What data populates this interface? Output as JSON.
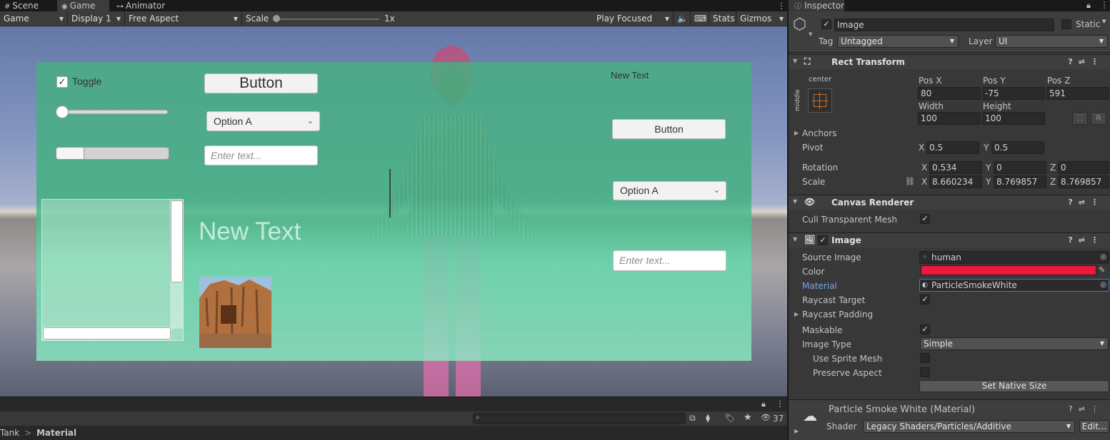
{
  "tabs": {
    "scene": "Scene",
    "game": "Game",
    "animator": "Animator",
    "more": "⋮"
  },
  "game_toolbar": {
    "mode": "Game",
    "display": "Display 1",
    "aspect": "Free Aspect",
    "scale_label": "Scale",
    "scale_value": "1x",
    "play_mode": "Play Focused",
    "stats": "Stats",
    "gizmos": "Gizmos"
  },
  "game_ui": {
    "toggle_label": "Toggle",
    "toggle_checked": "✓",
    "button1": "Button",
    "dropdown1": "Option A",
    "input1_placeholder": "Enter text...",
    "big_text": "New Text",
    "top_right_text": "New Text",
    "button2": "Button",
    "dropdown2": "Option A",
    "input2_placeholder": "Enter text...",
    "slider_value": 0.0,
    "progress_value": 0.25
  },
  "bottom_panel": {
    "search_placeholder": "",
    "hidden_count": "37",
    "breadcrumb_parent": "Tank",
    "breadcrumb_sep": ">",
    "breadcrumb_current": "Material"
  },
  "inspector": {
    "tab": "Inspector",
    "object_name": "Image",
    "active_checked": "✓",
    "static_label": "Static",
    "tag_label": "Tag",
    "tag_value": "Untagged",
    "layer_label": "Layer",
    "layer_value": "UI",
    "rect_transform": {
      "title": "Rect Transform",
      "anchor_h": "center",
      "anchor_v": "middle",
      "posx_label": "Pos X",
      "posy_label": "Pos Y",
      "posz_label": "Pos Z",
      "posx": "80",
      "posy": "-75",
      "posz": "591",
      "width_label": "Width",
      "height_label": "Height",
      "width": "100",
      "height": "100",
      "r_button": "R",
      "anchors_label": "Anchors",
      "pivot_label": "Pivot",
      "pivot_x": "0.5",
      "pivot_y": "0.5",
      "rotation_label": "Rotation",
      "rot_x": "0.534",
      "rot_y": "0",
      "rot_z": "0",
      "scale_label": "Scale",
      "scale_x": "8.660234",
      "scale_y": "8.769857",
      "scale_z": "8.769857",
      "x": "X",
      "y": "Y",
      "z": "Z"
    },
    "canvas_renderer": {
      "title": "Canvas Renderer",
      "cull_label": "Cull Transparent Mesh",
      "cull_checked": "✓"
    },
    "image": {
      "title": "Image",
      "enabled_checked": "✓",
      "source_label": "Source Image",
      "source_value": "human",
      "color_label": "Color",
      "color_value": "#f0183a",
      "material_label": "Material",
      "material_value": "ParticleSmokeWhite",
      "raycast_label": "Raycast Target",
      "raycast_checked": "✓",
      "padding_label": "Raycast Padding",
      "maskable_label": "Maskable",
      "maskable_checked": "✓",
      "type_label": "Image Type",
      "type_value": "Simple",
      "sprite_mesh_label": "Use Sprite Mesh",
      "preserve_label": "Preserve Aspect",
      "native_button": "Set Native Size"
    },
    "material": {
      "title": "Particle Smoke White (Material)",
      "shader_label": "Shader",
      "shader_value": "Legacy Shaders/Particles/Additive",
      "edit_button": "Edit..."
    }
  }
}
